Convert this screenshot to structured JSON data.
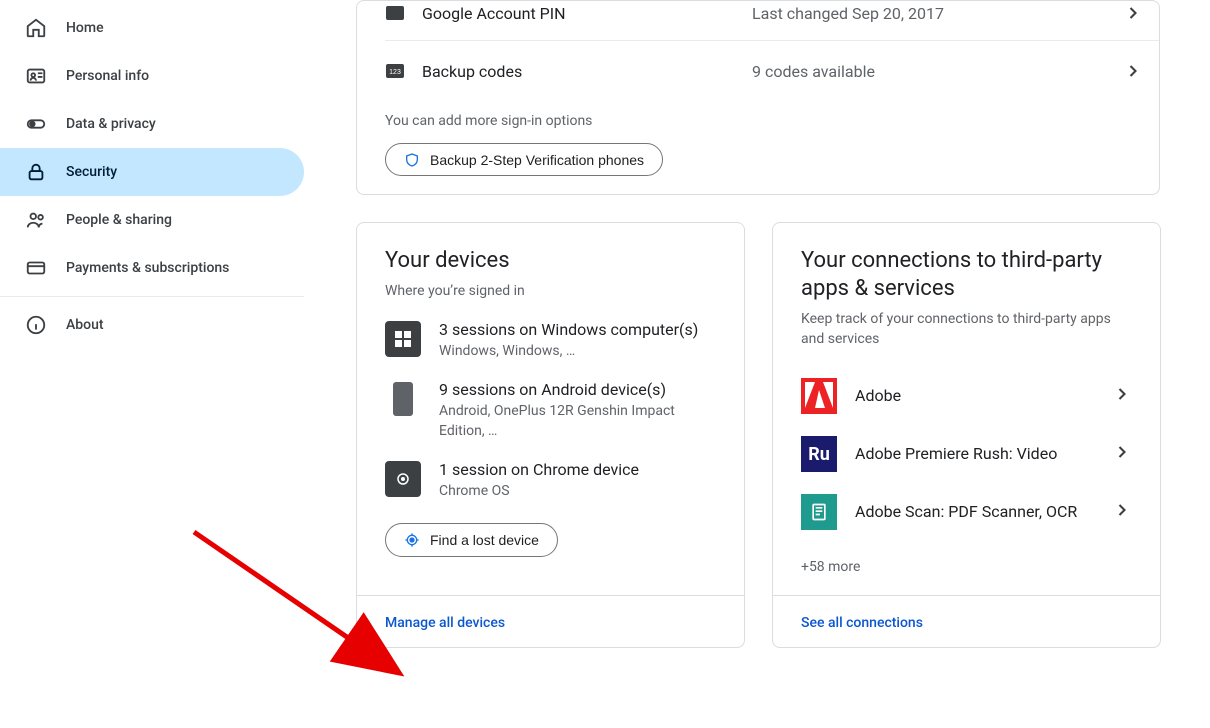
{
  "sidebar": {
    "items": [
      {
        "label": "Home"
      },
      {
        "label": "Personal info"
      },
      {
        "label": "Data & privacy"
      },
      {
        "label": "Security"
      },
      {
        "label": "People & sharing"
      },
      {
        "label": "Payments & subscriptions"
      },
      {
        "label": "About"
      }
    ]
  },
  "signin": {
    "pin_title": "Google Account PIN",
    "pin_value": "Last changed Sep 20, 2017",
    "backup_title": "Backup codes",
    "backup_value": "9 codes available",
    "hint": "You can add more sign-in options",
    "backup_phone_btn": "Backup 2-Step Verification phones"
  },
  "devices_panel": {
    "title": "Your devices",
    "subtitle": "Where you’re signed in",
    "items": [
      {
        "title": "3 sessions on Windows computer(s)",
        "sub": "Windows, Windows, …"
      },
      {
        "title": "9 sessions on Android device(s)",
        "sub": "Android, OnePlus 12R Genshin Impact Edition, …"
      },
      {
        "title": "1 session on Chrome device",
        "sub": "Chrome OS"
      }
    ],
    "find_btn": "Find a lost device",
    "manage_link": "Manage all devices"
  },
  "connections_panel": {
    "title": "Your connections to third-party apps & services",
    "subtitle": "Keep track of your connections to third-party apps and services",
    "apps": [
      {
        "label": "Adobe"
      },
      {
        "label": "Adobe Premiere Rush: Video"
      },
      {
        "label": "Adobe Scan: PDF Scanner, OCR"
      }
    ],
    "more": "+58 more",
    "see_all_link": "See all connections"
  }
}
